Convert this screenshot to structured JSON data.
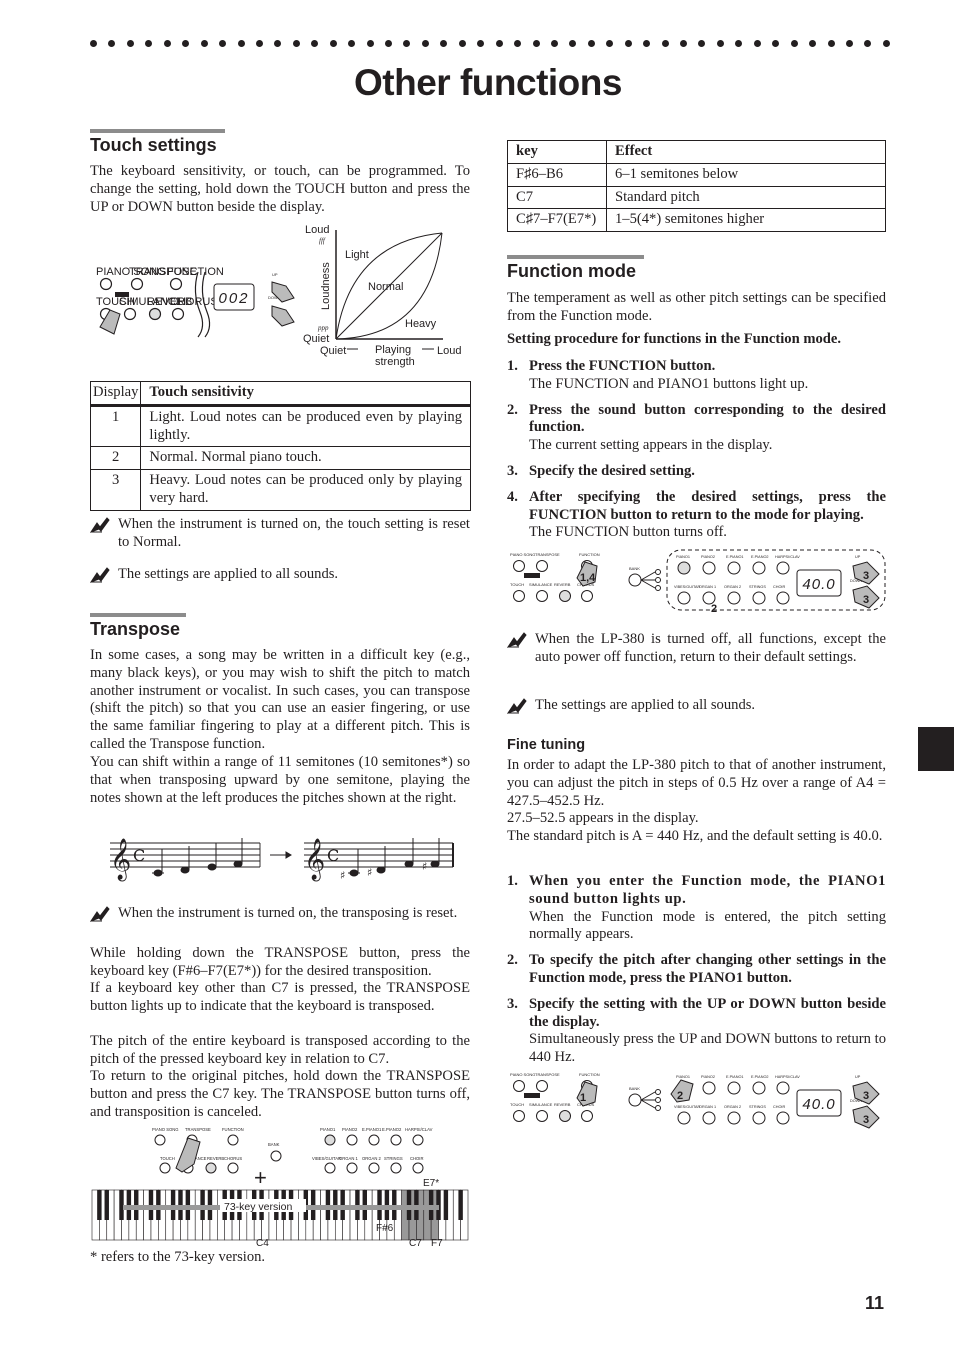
{
  "page": {
    "title": "Other functions",
    "page_number": "11"
  },
  "touch": {
    "heading": "Touch settings",
    "intro": "The keyboard sensitivity, or touch, can be programmed. To change the setting, hold down the TOUCH button and press the UP or DOWN button beside the display.",
    "panel": {
      "labels": [
        "PIANO SONG",
        "TRANSPOSE",
        "FUNCTION",
        "DEMO",
        "TOUCH",
        "SIMULANCE",
        "REVERB",
        "CHORUS",
        "UP",
        "DOWN"
      ],
      "display": "002"
    },
    "graph": {
      "y_top": "Loud",
      "y_bottom": "Quiet",
      "y_axis": "Loudness",
      "fff": "fff",
      "ppp": "ppp",
      "x_left": "Quiet",
      "x_right": "Loud",
      "x_axis_1": "Playing",
      "x_axis_2": "strength",
      "curve_light": "Light",
      "curve_normal": "Normal",
      "curve_heavy": "Heavy"
    },
    "table": {
      "headers": [
        "Display",
        "Touch sensitivity"
      ],
      "rows": [
        {
          "display": "1",
          "desc": "Light. Loud notes can be produced even by playing lightly."
        },
        {
          "display": "2",
          "desc": "Normal. Normal piano touch."
        },
        {
          "display": "3",
          "desc": "Heavy. Loud notes can be produced only by playing very hard."
        }
      ]
    },
    "notes": [
      "When the instrument is turned on, the touch setting is reset to Normal.",
      "The settings are applied to all sounds."
    ]
  },
  "transpose": {
    "heading": "Transpose",
    "para1": "In some cases, a song may be written in a difficult key (e.g., many black keys), or you may wish to shift the pitch to match another instrument or vocalist. In such cases, you can transpose (shift the pitch) so that you can use an easier fingering, or use the same familiar fingering to play at a different pitch. This is called the Transpose function.",
    "para2": "You can shift within a range of 11 semitones (10 semitones*) so that when transposing upward by one semitone, playing the notes shown at the left produces the pitches shown at the right.",
    "note": "When the instrument is turned on, the transposing is reset.",
    "para3": "While holding down the TRANSPOSE button, press the keyboard key (F#6–F7(E7*)) for the desired transposition.",
    "para4": "If a keyboard key other than C7 is pressed, the TRANSPOSE button lights up to indicate that the keyboard is transposed.",
    "para5": "The pitch of the entire keyboard is transposed according to the pitch of the pressed keyboard key in relation to C7.",
    "para6": "To return to the original pitches, hold down the TRANSPOSE button and press the C7 key. The TRANSPOSE button turns off, and transposition is canceled.",
    "keyboard": {
      "version_label": "73-key version",
      "label_c4": "C4",
      "label_fs6": "F#6",
      "label_c7": "C7",
      "label_f7": "F7",
      "label_e7": "E7*",
      "plus": "+"
    },
    "panel_right_labels": [
      "BANK",
      "PIANO1",
      "PIANO2",
      "E.PIANO1",
      "E.PIANO2",
      "HARPSI/CLAV",
      "VIBES/GUITAR",
      "ORGAN 1",
      "ORGAN 2",
      "STRINGS",
      "CHOIR"
    ],
    "footnote": "* refers to the 73-key version."
  },
  "key_table": {
    "headers": [
      "key",
      "Effect"
    ],
    "rows": [
      {
        "key": "F♯6–B6",
        "effect": "6–1 semitones below"
      },
      {
        "key": "C7",
        "effect": "Standard pitch"
      },
      {
        "key": "C♯7–F7(E7*)",
        "effect": "1–5(4*) semitones higher"
      }
    ]
  },
  "function_mode": {
    "heading": "Function mode",
    "intro": "The temperament as well as other pitch settings can be specified from the Function mode.",
    "procedure_title": "Setting procedure for functions in the Function mode.",
    "steps": [
      {
        "num": "1.",
        "bold": "Press the FUNCTION button.",
        "text": "The FUNCTION and PIANO1 buttons light up."
      },
      {
        "num": "2.",
        "bold": "Press the sound button corresponding to the desired function.",
        "text": "The current setting appears in the display."
      },
      {
        "num": "3.",
        "bold": "Specify the desired setting.",
        "text": ""
      },
      {
        "num": "4.",
        "bold": "After specifying the desired settings, press the FUNCTION button to return to the mode for playing.",
        "text": "The FUNCTION button turns off."
      }
    ],
    "diagram": {
      "display": "40.0",
      "marker_function": "1,4",
      "marker_sound": "2",
      "marker_updown": "3"
    },
    "notes": [
      "When the LP-380 is turned off, all functions, except the auto power off function, return to their default settings.",
      "The settings are applied to all sounds."
    ]
  },
  "fine_tuning": {
    "heading": "Fine tuning",
    "para1": "In order to adapt the LP-380 pitch to that of another instrument, you can adjust the pitch in steps of 0.5 Hz over a range of A4 = 427.5–452.5 Hz.",
    "para2": "27.5–52.5 appears in the display.",
    "para3": "The standard pitch is A = 440 Hz, and the default setting is 40.0.",
    "steps": [
      {
        "num": "1.",
        "bold": "When you enter the Function mode, the PIANO1 sound button lights up.",
        "text": "When the Function mode is entered, the pitch setting normally appears."
      },
      {
        "num": "2.",
        "bold": "To specify the pitch after changing other settings in the Function mode, press the PIANO1 button.",
        "text": ""
      },
      {
        "num": "3.",
        "bold": "Specify the setting with the UP or DOWN button beside the display.",
        "text": "Simultaneously press the UP and DOWN buttons to return to 440 Hz."
      }
    ],
    "diagram": {
      "display": "40.0",
      "marker_function": "1",
      "marker_sound": "2",
      "marker_updown": "3"
    }
  }
}
